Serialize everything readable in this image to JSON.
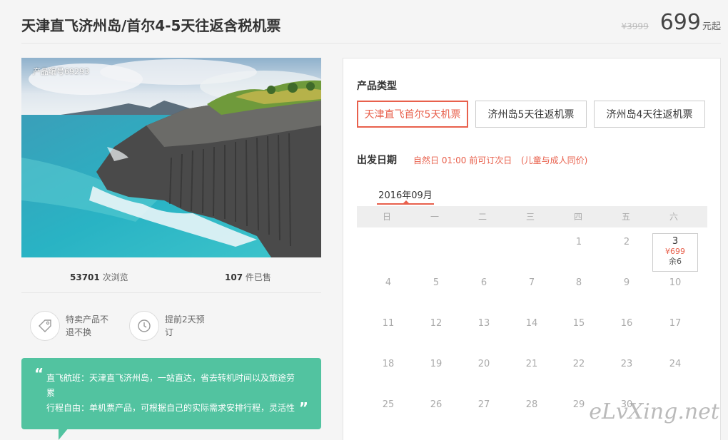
{
  "header": {
    "title": "天津直飞济州岛/首尔4-5天往返含税机票",
    "old_price": "¥3999",
    "price": "699",
    "price_unit": "元起"
  },
  "product": {
    "product_id": "产品编号69293",
    "views_count": "53701",
    "views_label": " 次浏览",
    "sold_count": "107",
    "sold_label": " 件已售"
  },
  "features": [
    {
      "icon": "tag-icon",
      "text": "特卖产品不退不换"
    },
    {
      "icon": "clock-icon",
      "text": "提前2天预订"
    }
  ],
  "quote": {
    "line1": "直飞航班：天津直飞济州岛，一站直达，省去转机时间以及旅途劳累",
    "line2": "行程自由：单机票产品，可根据自己的实际需求安排行程，灵活性"
  },
  "booking": {
    "type_title": "产品类型",
    "types": [
      "天津直飞首尔5天机票",
      "济州岛5天往返机票",
      "济州岛4天往返机票"
    ],
    "date_title": "出发日期",
    "note_time": "自然日 01:00 前可订次日",
    "note_price": "(儿童与成人同价)",
    "month": "2016年09月",
    "weekdays": [
      "日",
      "一",
      "二",
      "三",
      "四",
      "五",
      "六"
    ],
    "active_day": {
      "day": "3",
      "price": "¥699",
      "remain": "余6"
    },
    "days": [
      "1",
      "2",
      "4",
      "5",
      "6",
      "7",
      "8",
      "9",
      "10",
      "11",
      "12",
      "13",
      "14",
      "15",
      "16",
      "17",
      "18",
      "19",
      "20",
      "21",
      "22",
      "23",
      "24",
      "25",
      "26",
      "27",
      "28",
      "29",
      "30"
    ]
  },
  "watermark": "eLvXing.net",
  "colors": {
    "accent": "#e8604c",
    "teal": "#52c3a0"
  }
}
